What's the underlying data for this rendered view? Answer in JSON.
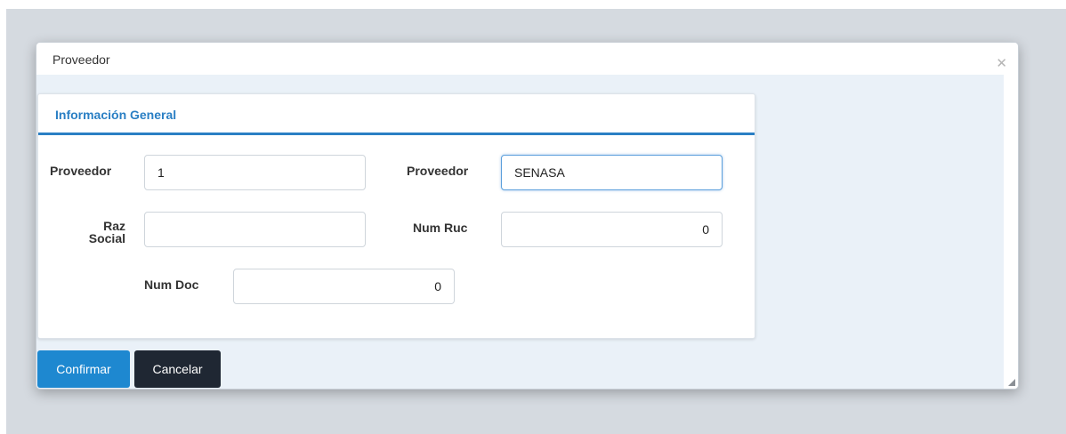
{
  "dialog": {
    "title": "Proveedor",
    "close_icon": "close-icon"
  },
  "panel": {
    "title": "Información General"
  },
  "form": {
    "proveedor_id_label": "Proveedor",
    "proveedor_id_value": "1",
    "proveedor_name_label": "Proveedor",
    "proveedor_name_value": "SENASA",
    "razon_social_label_1": "Raz",
    "razon_social_label_2": "Social",
    "razon_social_value": "",
    "num_ruc_label": "Num Ruc",
    "num_ruc_value": "0",
    "num_doc_label": "Num Doc",
    "num_doc_value": "0"
  },
  "actions": {
    "confirm_label": "Confirmar",
    "cancel_label": "Cancelar"
  },
  "colors": {
    "accent": "#2a7fc4",
    "confirm_button": "#1e88d0",
    "cancel_button": "#1f2733"
  }
}
